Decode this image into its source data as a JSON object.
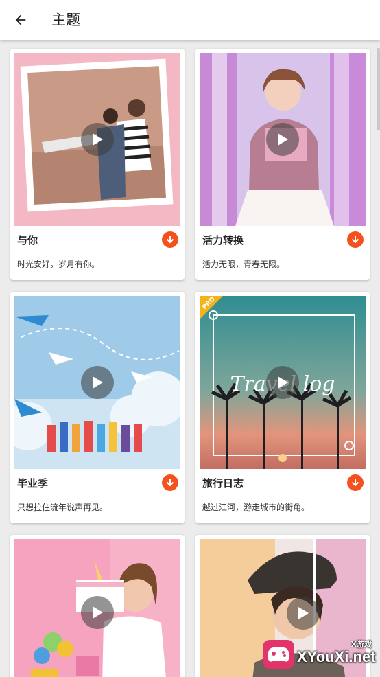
{
  "header": {
    "title": "主题",
    "back_icon": "arrow-left-icon"
  },
  "themes": [
    {
      "title": "与你",
      "description": "时光安好，岁月有你。",
      "action_icon": "download-icon"
    },
    {
      "title": "活力转换",
      "description": "活力无限，青春无限。",
      "action_icon": "download-icon"
    },
    {
      "title": "毕业季",
      "description": "只想拉住流年说声再见。",
      "action_icon": "download-icon"
    },
    {
      "title": "旅行日志",
      "description": "越过江河，游走城市的街角。",
      "action_icon": "download-icon",
      "badge": "PRO",
      "overlay_text": "Travel log"
    },
    {
      "title": "",
      "description": ""
    },
    {
      "title": "",
      "description": ""
    }
  ],
  "watermark": {
    "top_text": "X游戏",
    "main_text": "XYouXi.net"
  },
  "colors": {
    "accent": "#f4511e",
    "pro_badge": "#f2b31b",
    "background": "#ececec"
  }
}
